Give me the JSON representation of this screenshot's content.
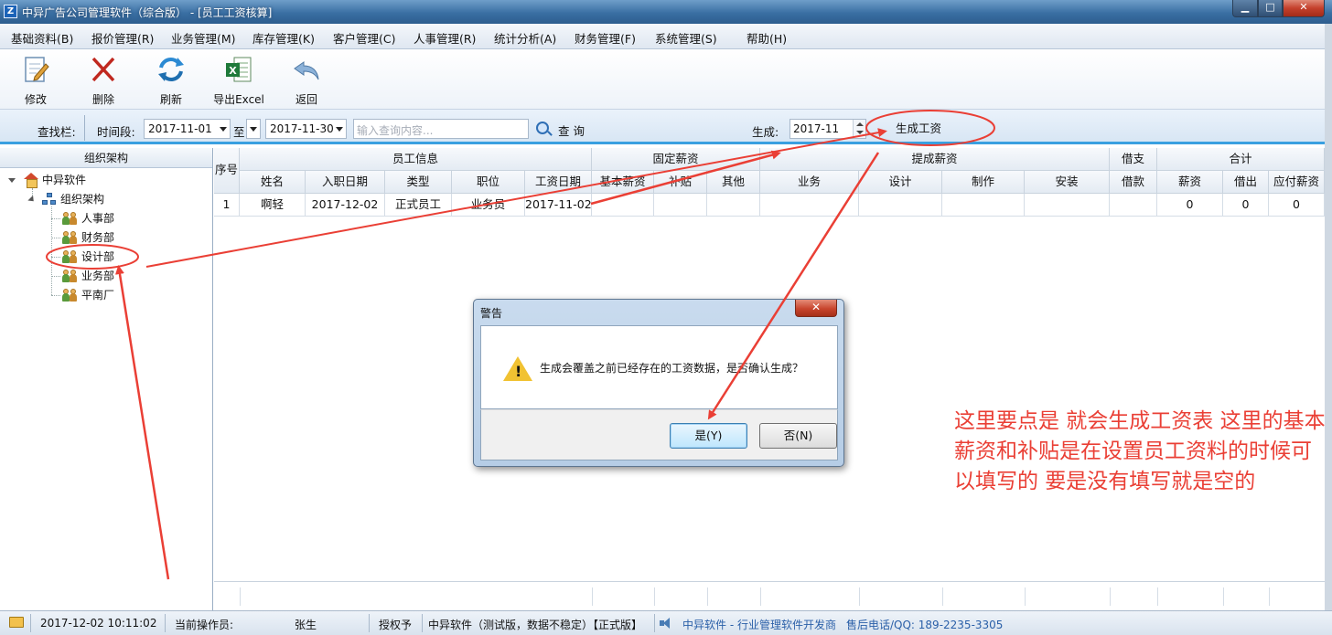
{
  "window": {
    "title": "中异广告公司管理软件（综合版） - [员工工资核算]",
    "app_icon": "Z",
    "minimize": "▁",
    "maximize": "□",
    "close": "✕"
  },
  "menu": [
    "基础资料(B)",
    "报价管理(R)",
    "业务管理(M)",
    "库存管理(K)",
    "客户管理(C)",
    "人事管理(R)",
    "统计分析(A)",
    "财务管理(F)",
    "系统管理(S)",
    "帮助(H)"
  ],
  "toolbar": {
    "edit": "修改",
    "delete": "删除",
    "refresh": "刷新",
    "export": "导出Excel",
    "back": "返回"
  },
  "search": {
    "bar_label": "查找栏:",
    "period_label": "时间段:",
    "date_from": "2017-11-01",
    "to_label": "至",
    "date_to": "2017-11-30",
    "placeholder": "输入查询内容...",
    "query_label": "查 询",
    "generate_label": "生成:",
    "month": "2017-11",
    "generate_button": "生成工资"
  },
  "tree": {
    "header": "组织架构",
    "root": "中异软件",
    "org": "组织架构",
    "departments": [
      "人事部",
      "财务部",
      "设计部",
      "业务部",
      "平南厂"
    ]
  },
  "grid": {
    "groups": {
      "seq": "序号",
      "employee_info": "员工信息",
      "fixed_salary": "固定薪资",
      "commission": "提成薪资",
      "loan": "借支",
      "total": "合计"
    },
    "columns": {
      "name": "姓名",
      "hire_date": "入职日期",
      "type": "类型",
      "position": "职位",
      "pay_date": "工资日期",
      "base_salary": "基本薪资",
      "allowance": "补贴",
      "other": "其他",
      "business": "业务",
      "design": "设计",
      "production": "制作",
      "install": "安装",
      "loan": "借款",
      "salary": "薪资",
      "advance": "借出",
      "payable": "应付薪资"
    },
    "rows": [
      {
        "seq": "1",
        "name": "啊轻",
        "hire_date": "2017-12-02",
        "type": "正式员工",
        "position": "业务员",
        "pay_date": "2017-11-02",
        "base_salary": "",
        "allowance": "",
        "other": "",
        "business": "",
        "design": "",
        "production": "",
        "install": "",
        "loan": "",
        "salary": "0",
        "advance": "0",
        "payable": "0"
      }
    ]
  },
  "dialog": {
    "title": "警告",
    "message": "生成会覆盖之前已经存在的工资数据，是否确认生成？",
    "yes": "是(Y)",
    "no": "否(N)",
    "icon": "warning-icon"
  },
  "status": {
    "datetime": "2017-12-02 10:11:02",
    "operator_label": "当前操作员:",
    "operator": "张生",
    "license_label": "授权予",
    "license": "中异软件（测试版，数据不稳定）【正式版】",
    "vendor": "中异软件 - 行业管理软件开发商",
    "phone": "售后电话/QQ: 189-2235-3305"
  },
  "annotation": {
    "text": "这里要点是 就会生成工资表 这里的基本薪资和补贴是在设置员工资料的时候可以填写的 要是没有填写就是空的",
    "color": "#ea3f35"
  }
}
